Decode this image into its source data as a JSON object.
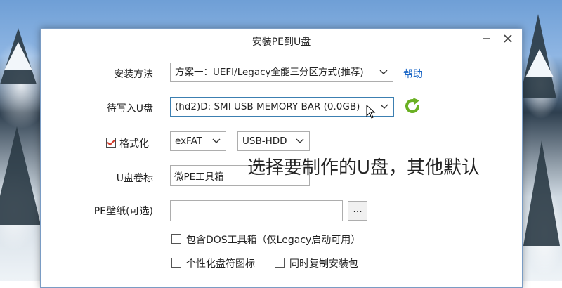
{
  "window": {
    "title": "安装PE到U盘",
    "minimize_icon": "minimize-icon",
    "close_icon": "close-icon"
  },
  "install_method": {
    "label": "安装方法",
    "selected": "方案一：UEFI/Legacy全能三分区方式(推荐)",
    "help_link": "帮助"
  },
  "target_drive": {
    "label": "待写入U盘",
    "selected": "(hd2)D: SMI USB MEMORY BAR (0.0GB)",
    "refresh_icon": "refresh-icon"
  },
  "format": {
    "label": "格式化",
    "checked": true,
    "filesystem": "exFAT",
    "mode": "USB-HDD"
  },
  "volume_label": {
    "label": "U盘卷标",
    "value": "微PE工具箱"
  },
  "wallpaper": {
    "label": "PE壁纸(可选)",
    "value": "",
    "browse_label": "..."
  },
  "options": [
    {
      "label": "包含DOS工具箱（仅Legacy启动可用）",
      "checked": false
    },
    {
      "label": "个性化盘符图标",
      "checked": false
    },
    {
      "label": "同时复制安装包",
      "checked": false
    }
  ],
  "caption": "选择要制作的U盘，其他默认",
  "colors": {
    "link": "#1a66c6",
    "check_mark": "#d23a2a",
    "refresh_arrow": "#6ab023",
    "focus_border": "#3c7fb1"
  }
}
